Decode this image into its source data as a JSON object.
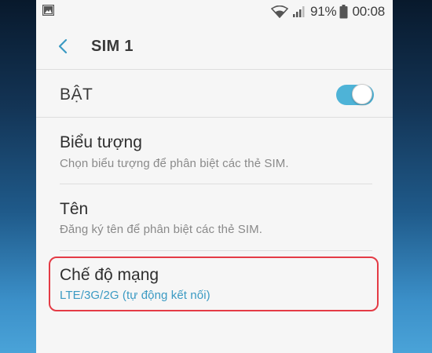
{
  "status_bar": {
    "battery_text": "91%",
    "time": "00:08",
    "icons": [
      "image-icon",
      "wifi-icon",
      "signal-icon",
      "battery-icon"
    ]
  },
  "toolbar": {
    "title": "SIM 1",
    "back_icon": "chevron-left-icon"
  },
  "toggle_row": {
    "label": "BẬT",
    "state": "on"
  },
  "items": [
    {
      "title": "Biểu tượng",
      "subtitle": "Chọn biểu tượng để phân biệt các thẻ SIM."
    },
    {
      "title": "Tên",
      "subtitle": "Đăng ký tên để phân biệt các thẻ SIM."
    },
    {
      "title": "Chế độ mạng",
      "subtitle": "LTE/3G/2G (tự động kết nối)"
    }
  ],
  "colors": {
    "accent": "#4eb3d7",
    "accent_text": "#3b9ac3",
    "highlight_border": "#e43b45",
    "panel_background": "#f6f6f6"
  }
}
